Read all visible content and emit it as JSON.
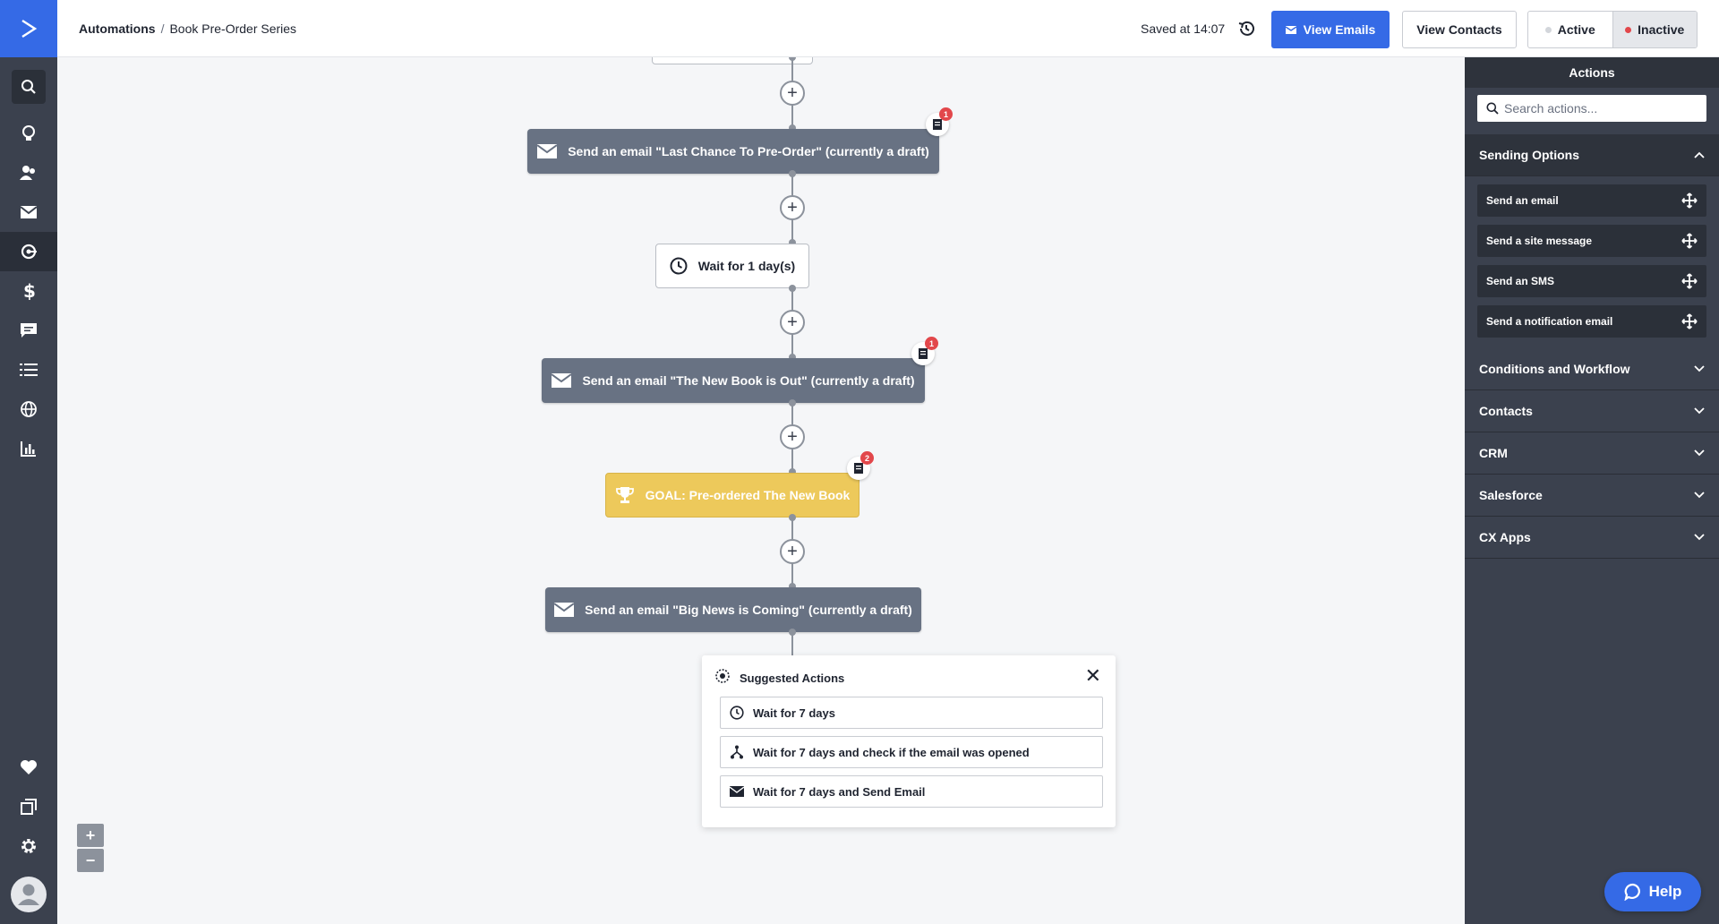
{
  "header": {
    "breadcrumb_root": "Automations",
    "breadcrumb_sep": "/",
    "breadcrumb_current": "Book Pre-Order Series",
    "saved_text": "Saved at 14:07",
    "view_emails": "View Emails",
    "view_contacts": "View Contacts",
    "status_active": "Active",
    "status_inactive": "Inactive"
  },
  "workflow": {
    "nodes": [
      {
        "type": "email",
        "label": "Send an email \"Last Chance To Pre-Order\" (currently a draft)",
        "badge": "1"
      },
      {
        "type": "wait",
        "label": "Wait for 1 day(s)"
      },
      {
        "type": "email",
        "label": "Send an email \"The New Book is Out\" (currently a draft)",
        "badge": "1"
      },
      {
        "type": "goal",
        "label": "GOAL: Pre-ordered The New Book",
        "badge": "2"
      },
      {
        "type": "email",
        "label": "Send an email \"Big News is Coming\" (currently a draft)"
      }
    ],
    "plus_symbol": "+"
  },
  "suggested": {
    "title": "Suggested Actions",
    "close": "✕",
    "items": [
      {
        "icon": "clock-icon",
        "label": "Wait for 7 days"
      },
      {
        "icon": "split-icon",
        "label": "Wait for 7 days and check if the email was opened"
      },
      {
        "icon": "envelope-icon",
        "label": "Wait for 7 days and Send Email"
      }
    ]
  },
  "zoom": {
    "in": "+",
    "out": "−"
  },
  "panel": {
    "title": "Actions",
    "search_placeholder": "Search actions...",
    "sections": [
      {
        "label": "Sending Options",
        "open": true
      },
      {
        "label": "Conditions and Workflow"
      },
      {
        "label": "Contacts"
      },
      {
        "label": "CRM"
      },
      {
        "label": "Salesforce"
      },
      {
        "label": "CX Apps"
      }
    ],
    "sending_items": [
      "Send an email",
      "Send a site message",
      "Send an SMS",
      "Send a notification email"
    ]
  },
  "help_label": "Help",
  "colors": {
    "accent": "#356ae6",
    "nav": "#3b414e",
    "email_node": "#687283",
    "goal_node": "#edc95b",
    "inactive_dot": "#e2474b",
    "badge": "#e2474b"
  }
}
